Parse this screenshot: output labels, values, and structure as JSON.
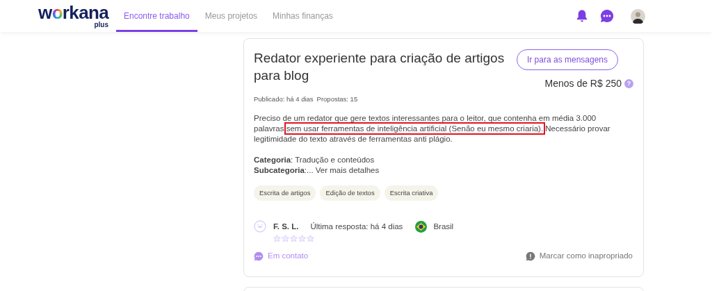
{
  "header": {
    "logo": "workana",
    "logo_sub": "plus",
    "nav": [
      {
        "label": "Encontre trabalho",
        "selected": true
      },
      {
        "label": "Meus projetos",
        "selected": false
      },
      {
        "label": "Minhas finanças",
        "selected": false
      }
    ]
  },
  "project": {
    "title": "Redator experiente para criação de artigos para blog",
    "button": "Ir para as mensagens",
    "budget": "Menos de R$ 250",
    "help": "?",
    "published": "Publicado: há 4 dias",
    "proposals": "Propostas: 15",
    "description": {
      "before": "Preciso de um redator que gere textos interessantes para o leitor, que contenha em média 3.000 palavras",
      "highlighted": "sem usar ferramentas de inteligência artificial (Senão eu mesmo criaria).",
      "after": "Necessário provar legitimidade do texto através de ferramentas anti plágio."
    },
    "category": "**Categoria**: Tradução e conteúdos",
    "subcategory": "**Subcategoria**:... Ver mais detalhes",
    "skills": [
      "Escrita de artigos",
      "Edição de textos",
      "Escrita criativa"
    ],
    "client": {
      "name": "F. S. L.",
      "last_reply": "Última resposta: há 4 dias",
      "country": "Brasil",
      "stars": 0
    },
    "status": "Em contato",
    "report": "Marcar como inapropriado"
  }
}
